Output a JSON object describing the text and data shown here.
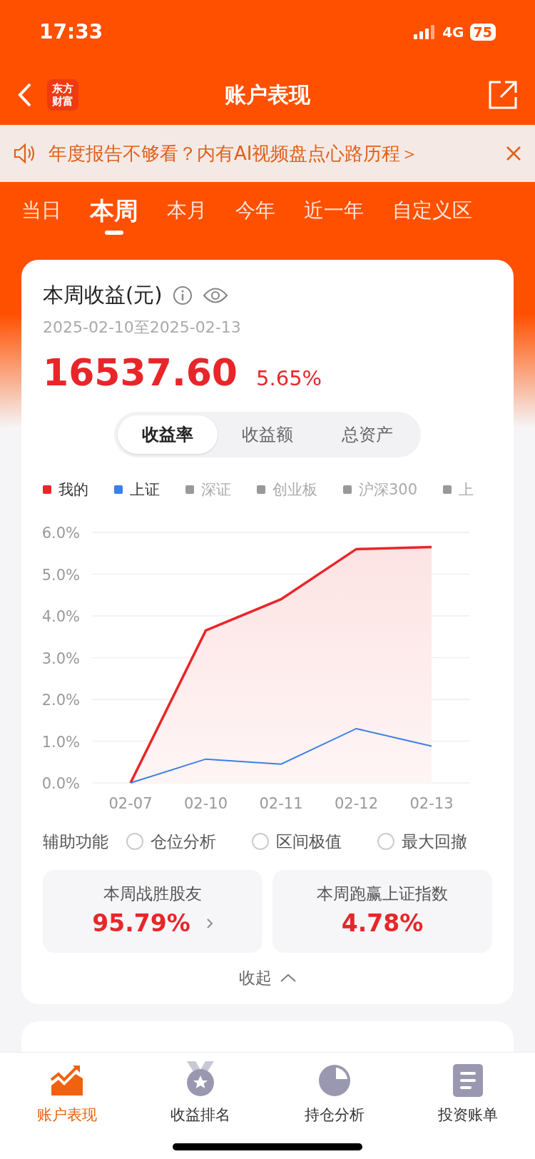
{
  "status_bar": {
    "time": "17:33",
    "network": "4G",
    "battery": "75"
  },
  "nav": {
    "logo_lines": [
      "东方",
      "财富"
    ],
    "title": "账户表现"
  },
  "notice": {
    "text": "年度报告不够看？内有AI视频盘点心路历程＞"
  },
  "period_tabs": [
    {
      "label": "当日",
      "selected": false
    },
    {
      "label": "本周",
      "selected": true
    },
    {
      "label": "本月",
      "selected": false
    },
    {
      "label": "今年",
      "selected": false
    },
    {
      "label": "近一年",
      "selected": false
    },
    {
      "label": "自定义区",
      "selected": false
    }
  ],
  "summary": {
    "title": "本周收益(元)",
    "date_range": "2025-02-10至2025-02-13",
    "amount": "16537.60",
    "rate": "5.65%"
  },
  "metric_tabs": [
    {
      "label": "收益率",
      "selected": true
    },
    {
      "label": "收益额",
      "selected": false
    },
    {
      "label": "总资产",
      "selected": false
    }
  ],
  "legend_extra": [
    {
      "label": "深证",
      "on": false
    },
    {
      "label": "创业板",
      "on": false
    },
    {
      "label": "沪深300",
      "on": false
    },
    {
      "label": "上",
      "on": false
    }
  ],
  "chart_data": {
    "type": "area",
    "grid": true,
    "categories": [
      "02-07",
      "02-10",
      "02-11",
      "02-12",
      "02-13"
    ],
    "ylim": [
      0,
      6
    ],
    "yticks": [
      {
        "value": 0,
        "label": "0.0%"
      },
      {
        "value": 1,
        "label": "1.0%"
      },
      {
        "value": 2,
        "label": "2.0%"
      },
      {
        "value": 3,
        "label": "3.0%"
      },
      {
        "value": 4,
        "label": "4.0%"
      },
      {
        "value": 5,
        "label": "5.0%"
      },
      {
        "value": 6,
        "label": "6.0%"
      }
    ],
    "series": [
      {
        "name": "我的",
        "color": "#e8262a",
        "type": "area",
        "values": [
          0,
          3.65,
          4.4,
          5.6,
          5.65
        ]
      },
      {
        "name": "上证",
        "color": "#3b7fe8",
        "type": "line",
        "values": [
          0,
          0.57,
          0.45,
          1.3,
          0.88
        ]
      }
    ]
  },
  "aux": {
    "label": "辅助功能",
    "options": [
      {
        "label": "仓位分析",
        "checked": false
      },
      {
        "label": "区间极值",
        "checked": false
      },
      {
        "label": "最大回撤",
        "checked": false
      }
    ]
  },
  "stats": [
    {
      "kind": "link",
      "label": "本周战胜股友",
      "value": "95.79%"
    },
    {
      "kind": "plain",
      "label": "本周跑赢上证指数",
      "value": "4.78%"
    }
  ],
  "collapse": "收起",
  "bottom_nav": [
    {
      "kind": "trend",
      "label": "账户表现",
      "selected": true
    },
    {
      "kind": "medal",
      "label": "收益排名",
      "selected": false
    },
    {
      "kind": "pie",
      "label": "持仓分析",
      "selected": false
    },
    {
      "kind": "doc",
      "label": "投资账单",
      "selected": false
    }
  ]
}
